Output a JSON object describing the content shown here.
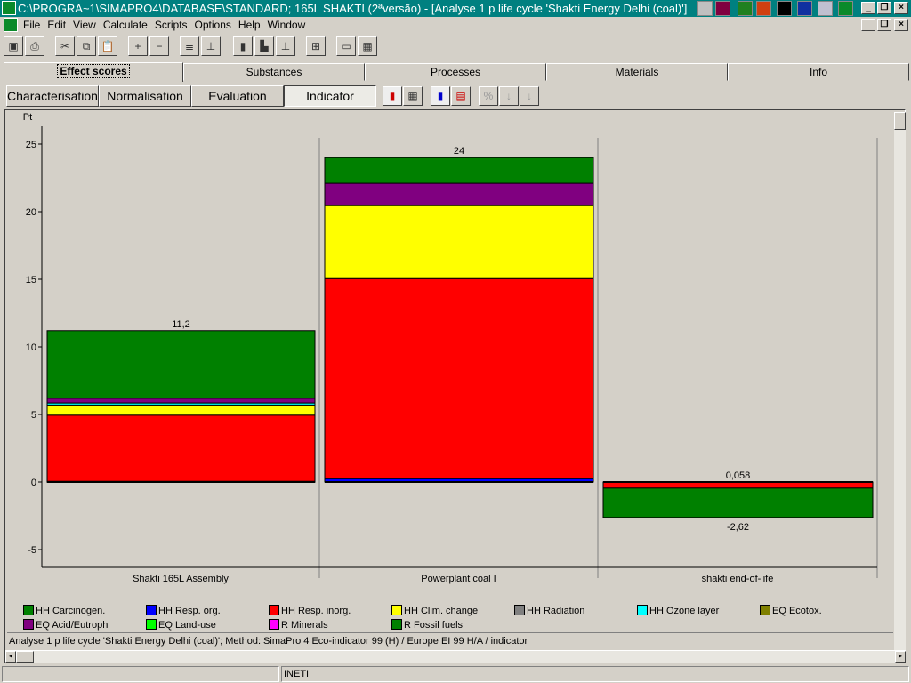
{
  "window": {
    "title": "C:\\PROGRA~1\\SIMAPRO4\\DATABASE\\STANDARD; 165L SHAKTI (2ªversão) - [Analyse 1 p life cycle 'Shakti Energy Delhi (coal)']"
  },
  "menu": [
    "File",
    "Edit",
    "View",
    "Calculate",
    "Scripts",
    "Options",
    "Help",
    "Window"
  ],
  "tabs": [
    "Effect scores",
    "Substances",
    "Processes",
    "Materials",
    "Info"
  ],
  "active_tab": "Effect scores",
  "subtabs": [
    "Characterisation",
    "Normalisation",
    "Evaluation",
    "Indicator"
  ],
  "active_subtab": "Indicator",
  "status_text": "Analyse 1 p life cycle 'Shakti Energy Delhi (coal)';  Method: SimaPro 4 Eco-indicator 99 (H) /  Europe EI 99 H/A / indicator",
  "statusbar": {
    "panel2": "INETI"
  },
  "chart_data": {
    "type": "bar",
    "stacked": true,
    "ylabel": "Pt",
    "ylim": [
      -6,
      26
    ],
    "yticks": [
      -5,
      0,
      5,
      10,
      15,
      20,
      25
    ],
    "categories": [
      "Shakti 165L Assembly",
      "Powerplant coal I",
      "shakti end-of-life"
    ],
    "totals_labels": [
      [
        "11,2"
      ],
      [
        "24"
      ],
      [
        "0,058",
        "-2,62"
      ]
    ],
    "series": [
      {
        "name": "HH Carcinogen.",
        "color": "#008000",
        "values": [
          0.05,
          0,
          0
        ]
      },
      {
        "name": "HH Resp. org.",
        "color": "#0000ff",
        "values": [
          0,
          0.25,
          0
        ]
      },
      {
        "name": "HH Resp. inorg.",
        "color": "#ff0000",
        "values": [
          4.9,
          14.8,
          -0.45
        ]
      },
      {
        "name": "HH Clim. change",
        "color": "#ffff00",
        "values": [
          0.75,
          5.4,
          0
        ]
      },
      {
        "name": "HH Radiation",
        "color": "#808080",
        "values": [
          0,
          0,
          0
        ]
      },
      {
        "name": "HH Ozone layer",
        "color": "#00ffff",
        "values": [
          0.15,
          0,
          0
        ]
      },
      {
        "name": "EQ Ecotox.",
        "color": "#808000",
        "values": [
          0,
          0,
          0
        ]
      },
      {
        "name": "EQ Acid/Eutroph",
        "color": "#800080",
        "values": [
          0.35,
          1.65,
          0
        ]
      },
      {
        "name": "EQ Land-use",
        "color": "#00ff00",
        "values": [
          0,
          0,
          0
        ]
      },
      {
        "name": "R Minerals",
        "color": "#ff00ff",
        "values": [
          0,
          0,
          0
        ]
      },
      {
        "name": "R Fossil fuels",
        "color": "#008000",
        "values": [
          5.0,
          1.9,
          -2.17
        ]
      }
    ]
  }
}
